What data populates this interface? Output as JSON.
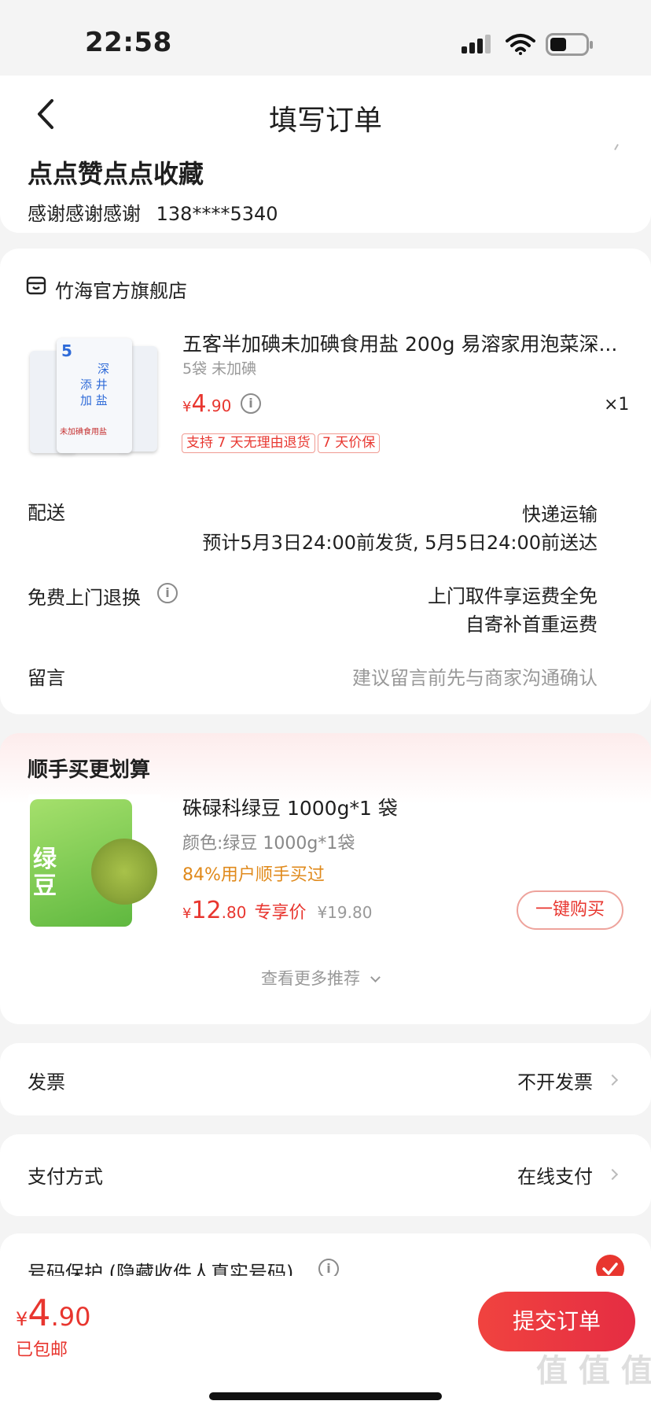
{
  "status_bar": {
    "time": "22:58"
  },
  "header": {
    "title": "填写订单"
  },
  "address": {
    "name": "点点赞点点收藏",
    "recipient": "感谢感谢感谢",
    "phone": "138****5340"
  },
  "shop": {
    "name": "竹海官方旗舰店",
    "product": {
      "title": "五客半加碘未加碘食用盐 200g 易溶家用泡菜深...",
      "spec": "5袋 未加碘",
      "price_symbol": "¥",
      "price_int": "4",
      "price_dec": ".90",
      "quantity": "×1",
      "tags": [
        "支持 7 天无理由退货",
        "7 天价保"
      ],
      "image_text": {
        "brand": "5",
        "line1": "深",
        "line2": "添 井",
        "line3": "加 盐",
        "label": "未加碘食用盐"
      }
    },
    "delivery": {
      "label": "配送",
      "method": "快递运输",
      "estimate": "预计5月3日24:00前发货, 5月5日24:00前送达"
    },
    "free_return": {
      "label": "免费上门退换",
      "line1": "上门取件享运费全免",
      "line2": "自寄补首重运费"
    },
    "message": {
      "label": "留言",
      "placeholder": "建议留言前先与商家沟通确认"
    }
  },
  "recommend": {
    "title": "顺手买更划算",
    "item": {
      "title": "硃碌科绿豆 1000g*1 袋",
      "spec": "颜色:绿豆 1000g*1袋",
      "stat": "84%用户顺手买过",
      "price_symbol": "¥",
      "price_int": "12",
      "price_dec": ".80",
      "price_label": "专享价",
      "original_price": "¥19.80",
      "buy_label": "一键购买",
      "image_text": "绿豆"
    },
    "more_label": "查看更多推荐"
  },
  "invoice": {
    "label": "发票",
    "value": "不开发票"
  },
  "payment": {
    "label": "支付方式",
    "value": "在线支付"
  },
  "privacy": {
    "label": "号码保护 (隐藏收件人真实号码)",
    "checked": true
  },
  "footer": {
    "price_symbol": "¥",
    "price_int": "4",
    "price_dec": ".90",
    "shipping": "已包邮",
    "submit_label": "提交订单"
  },
  "watermark": "值 值 值",
  "colors": {
    "accent": "#e8362f",
    "highlight": "#e08a1c",
    "background": "#f4f4f4"
  },
  "icons": [
    "back-icon",
    "shop-icon",
    "info-icon",
    "chevron-right-icon",
    "chevron-down-icon",
    "check-icon",
    "wifi-icon",
    "battery-icon",
    "signal-icon"
  ]
}
